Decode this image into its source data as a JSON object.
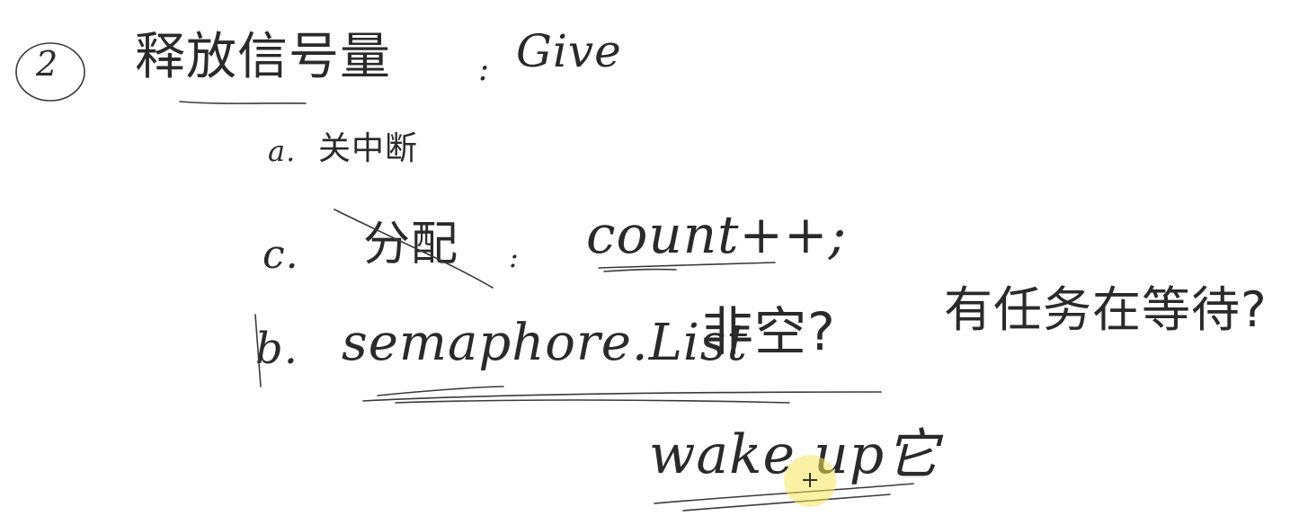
{
  "note": {
    "section_marker": "2",
    "title_cn": "释放信号量",
    "title_sep": ":",
    "title_en": "Give",
    "step_a_label": "a.",
    "step_a_text": "关中断",
    "step_c_label": "c.",
    "step_c_struck": "分配",
    "step_c_sep": ":",
    "step_c_code": "count++;",
    "step_b_label": "b.",
    "step_b_list": "semaphore.List",
    "step_b_text": "非空?",
    "step_b_question": "有任务在等待?",
    "wake_text": "wake up它"
  },
  "ink_color": "#2a2a2a",
  "highlight_color": "#f5e65a"
}
